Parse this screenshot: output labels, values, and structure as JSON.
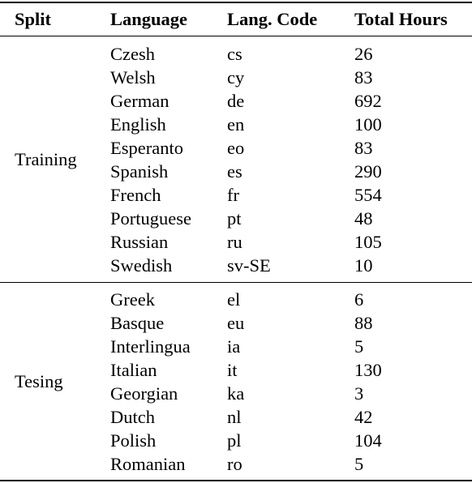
{
  "table": {
    "headers": {
      "split": "Split",
      "language": "Language",
      "code": "Lang. Code",
      "hours": "Total Hours"
    },
    "sections": [
      {
        "split": "Training",
        "rows": [
          {
            "language": "Czesh",
            "code": "cs",
            "hours": "26"
          },
          {
            "language": "Welsh",
            "code": "cy",
            "hours": "83"
          },
          {
            "language": "German",
            "code": "de",
            "hours": "692"
          },
          {
            "language": "English",
            "code": "en",
            "hours": "100"
          },
          {
            "language": "Esperanto",
            "code": "eo",
            "hours": "83"
          },
          {
            "language": "Spanish",
            "code": "es",
            "hours": "290"
          },
          {
            "language": "French",
            "code": "fr",
            "hours": "554"
          },
          {
            "language": "Portuguese",
            "code": "pt",
            "hours": "48"
          },
          {
            "language": "Russian",
            "code": "ru",
            "hours": "105"
          },
          {
            "language": "Swedish",
            "code": "sv-SE",
            "hours": "10"
          }
        ]
      },
      {
        "split": "Tesing",
        "rows": [
          {
            "language": "Greek",
            "code": "el",
            "hours": "6"
          },
          {
            "language": "Basque",
            "code": "eu",
            "hours": "88"
          },
          {
            "language": "Interlingua",
            "code": "ia",
            "hours": "5"
          },
          {
            "language": "Italian",
            "code": "it",
            "hours": "130"
          },
          {
            "language": "Georgian",
            "code": "ka",
            "hours": "3"
          },
          {
            "language": "Dutch",
            "code": "nl",
            "hours": "42"
          },
          {
            "language": "Polish",
            "code": "pl",
            "hours": "104"
          },
          {
            "language": "Romanian",
            "code": "ro",
            "hours": "5"
          }
        ]
      }
    ]
  }
}
